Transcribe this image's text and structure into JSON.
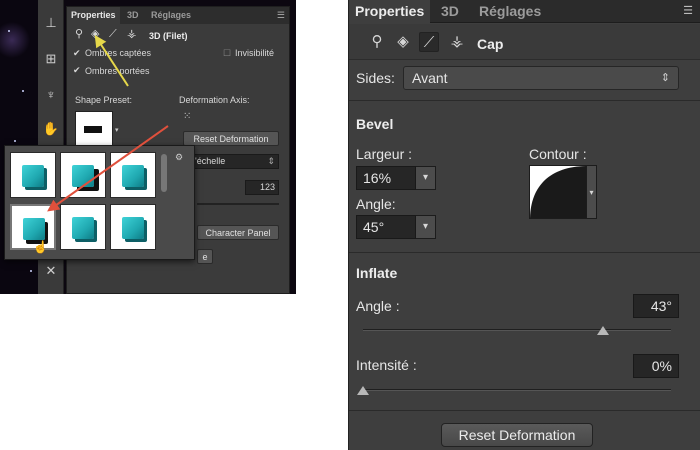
{
  "left": {
    "tabs": [
      "Properties",
      "3D",
      "Réglages"
    ],
    "panel_title": "3D (Filet)",
    "shadows": {
      "catch": "Ombres captées",
      "cast": "Ombres portées",
      "invisible": "Invisibilité"
    },
    "shape_preset_label": "Shape Preset:",
    "deformation_axis_label": "Deformation Axis:",
    "reset_deformation": "Reset Deformation",
    "scale_option": "l'échelle",
    "value_field": "123",
    "character_panel": "Character Panel",
    "partial_button": "e",
    "colors": {
      "arrow_yellow": "#e6d84a",
      "arrow_red": "#e0503c",
      "cube": "#2fc0c8"
    }
  },
  "right": {
    "tabs": [
      "Properties",
      "3D",
      "Réglages"
    ],
    "title": "Cap",
    "sides": {
      "label": "Sides:",
      "value": "Avant"
    },
    "bevel": {
      "heading": "Bevel",
      "width_label": "Largeur :",
      "width_value": "16%",
      "contour_label": "Contour :",
      "angle_label": "Angle:",
      "angle_value": "45°"
    },
    "inflate": {
      "heading": "Inflate",
      "angle_label": "Angle :",
      "angle_value": "43°",
      "angle_fraction": 0.78,
      "intensity_label": "Intensité :",
      "intensity_value": "0%",
      "intensity_fraction": 0.0
    },
    "reset_deformation": "Reset Deformation"
  }
}
